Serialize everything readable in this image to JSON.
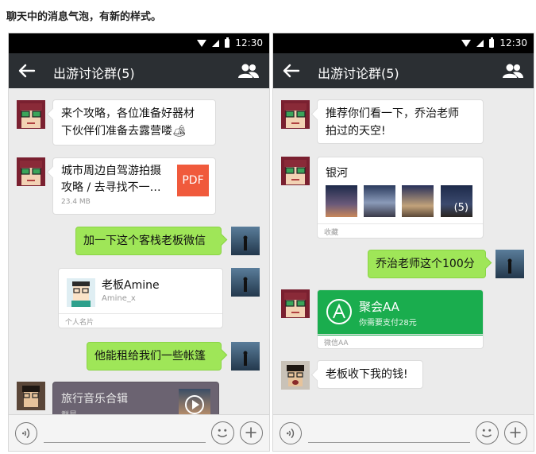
{
  "caption": "聊天中的消息气泡，有新的样式。",
  "status": {
    "time": "12:30"
  },
  "nav": {
    "title": "出游讨论群(5)"
  },
  "phoneA": {
    "msg1": [
      "来个攻略，各位准备好器材",
      "下伙伴们准备去露营喽🏕"
    ],
    "file": {
      "title_line1": "城市周边自驾游拍摄",
      "title_line2": "攻略 / 去寻找不一…",
      "size": "23.4 MB",
      "type": "PDF"
    },
    "msg2": "加一下这个客栈老板微信",
    "contact": {
      "name": "老板Amine",
      "id": "Amine_x",
      "footer": "个人名片"
    },
    "msg3": "他能租给我们一些帐篷",
    "music": {
      "title": "旅行音乐合辑",
      "artist": "群星"
    }
  },
  "phoneB": {
    "msg1": [
      "推荐你们看一下，乔治老师",
      "拍过的天空!"
    ],
    "album": {
      "title": "银河",
      "more": "(5)",
      "footer": "收藏"
    },
    "msg2": "乔治老师这个100分",
    "aa": {
      "title": "聚会AA",
      "subtitle": "你需要支付28元",
      "footer": "微信AA"
    },
    "msg3": "老板收下我的钱!"
  },
  "colors": {
    "nav_bg": "#2b2f33",
    "bubble_green": "#9fe658",
    "aa_green": "#1aad4e",
    "pdf_red": "#f05a3c"
  },
  "icons": [
    "back-arrow-icon",
    "group-members-icon",
    "voice-icon",
    "emoji-icon",
    "plus-icon",
    "play-icon",
    "wifi-icon",
    "signal-icon",
    "battery-icon",
    "aa-logo-icon"
  ]
}
